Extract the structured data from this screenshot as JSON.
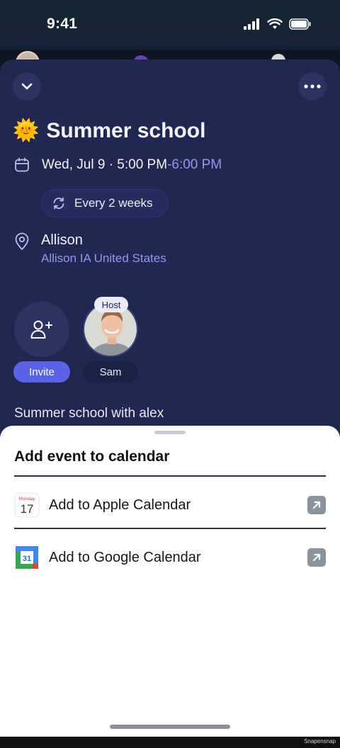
{
  "status_bar": {
    "time": "9:41"
  },
  "event": {
    "emoji": "🌞",
    "title": "Summer school",
    "date_start": "Wed, Jul 9 · 5:00 PM",
    "date_end": "-6:00 PM",
    "recurrence": "Every 2 weeks",
    "location_name": "Allison",
    "location_address": "Allison IA United States",
    "description": "Summer school with alex"
  },
  "people": {
    "invite_label": "Invite",
    "host_badge": "Host",
    "host_name": "Sam"
  },
  "calendar_sheet": {
    "title": "Add event to calendar",
    "apple": {
      "label": "Add to Apple Calendar",
      "icon_month": "Monday",
      "icon_day": "17"
    },
    "google": {
      "label": "Add to Google Calendar",
      "icon_day": "31"
    }
  },
  "watermark": "Snapensnap",
  "colors": {
    "sheet_bg": "#222752",
    "accent": "#5a62e6",
    "end_time": "#8f9ae8"
  }
}
